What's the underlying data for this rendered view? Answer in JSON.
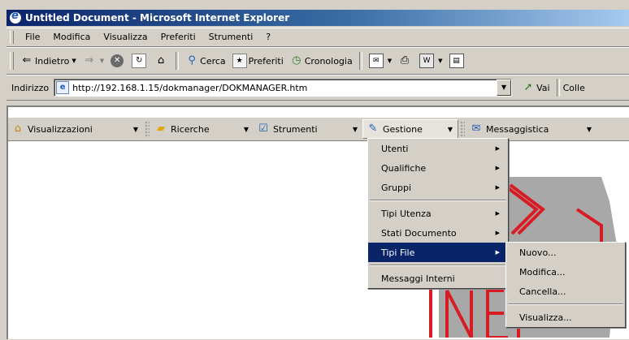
{
  "window": {
    "title": "Untitled Document - Microsoft Internet Explorer"
  },
  "menubar": {
    "items": [
      "File",
      "Modifica",
      "Visualizza",
      "Preferiti",
      "Strumenti",
      "?"
    ]
  },
  "toolbar": {
    "back": "Indietro",
    "search": "Cerca",
    "favorites": "Preferiti",
    "history": "Cronologia"
  },
  "address": {
    "label": "Indirizzo",
    "url": "http://192.168.1.15/dokmanager/DOKMANAGER.htm",
    "go": "Vai",
    "links": "Colle"
  },
  "app_toolbar": {
    "items": [
      {
        "label": "Visualizzazioni",
        "icon": "house-icon"
      },
      {
        "label": "Ricerche",
        "icon": "folders-icon"
      },
      {
        "label": "Strumenti",
        "icon": "tools-icon"
      },
      {
        "label": "Gestione",
        "icon": "edit-icon"
      },
      {
        "label": "Messaggistica",
        "icon": "message-icon"
      }
    ]
  },
  "gestione_menu": {
    "items": [
      "Utenti",
      "Qualifiche",
      "Gruppi",
      "Tipi Utenza",
      "Stati Documento",
      "Tipi File",
      "Messaggi Interni"
    ],
    "selected": "Tipi File"
  },
  "tipi_file_menu": {
    "items": [
      "Nuovo...",
      "Modifica...",
      "Cancella...",
      "Visualizza..."
    ]
  },
  "colors": {
    "selection": "#0a246a",
    "chrome": "#d4d0c8",
    "logo_red": "#d81c24",
    "logo_gray": "#a8a8a8"
  }
}
